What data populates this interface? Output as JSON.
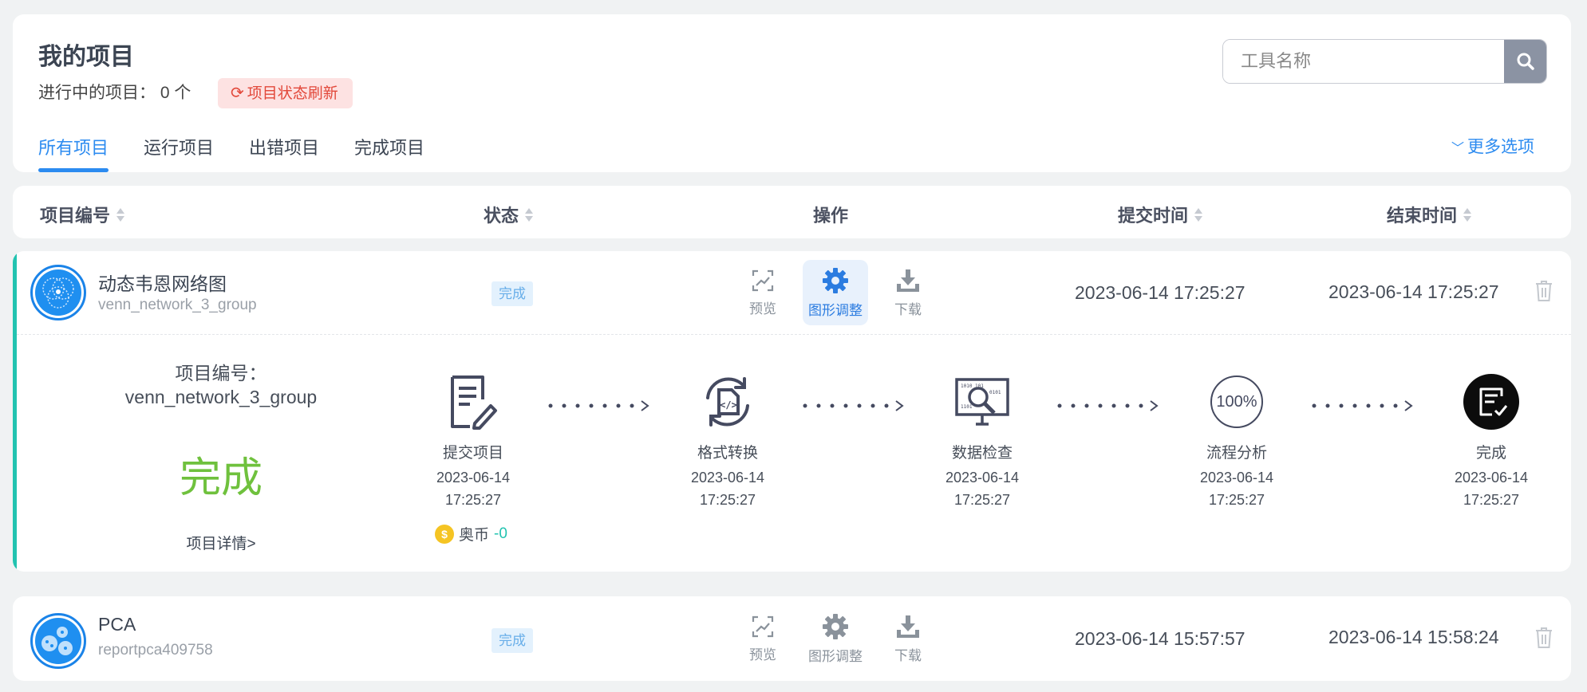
{
  "header": {
    "title": "我的项目",
    "running_label": "进行中的项目：",
    "running_count": "0 个",
    "refresh_label": "项目状态刷新",
    "search_placeholder": "工具名称",
    "more_options": "更多选项",
    "tabs": [
      "所有项目",
      "运行项目",
      "出错项目",
      "完成项目"
    ],
    "active_tab": "所有项目"
  },
  "columns": [
    "项目编号",
    "状态",
    "操作",
    "提交时间",
    "结束时间"
  ],
  "operations": [
    "预览",
    "图形调整",
    "下载"
  ],
  "projects": [
    {
      "name": "动态韦恩网络图",
      "id": "venn_network_3_group",
      "status": "完成",
      "submit_time": "2023-06-14 17:25:27",
      "end_time": "2023-06-14 17:25:27",
      "expanded": true
    },
    {
      "name": "PCA",
      "id": "reportpca409758",
      "status": "完成",
      "submit_time": "2023-06-14 15:57:57",
      "end_time": "2023-06-14 15:58:24",
      "expanded": false
    }
  ],
  "detail": {
    "id_label": "项目编号：",
    "id_value": "venn_network_3_group",
    "status": "完成",
    "details_link": "项目详情>",
    "coin_label": "奥币",
    "coin_amount": "-0",
    "steps": [
      {
        "name": "提交项目",
        "date": "2023-06-14",
        "time": "17:25:27"
      },
      {
        "name": "格式转换",
        "date": "2023-06-14",
        "time": "17:25:27"
      },
      {
        "name": "数据检查",
        "date": "2023-06-14",
        "time": "17:25:27"
      },
      {
        "name": "流程分析",
        "date": "2023-06-14",
        "time": "17:25:27",
        "badge": "100%"
      },
      {
        "name": "完成",
        "date": "2023-06-14",
        "time": "17:25:27"
      }
    ]
  },
  "colors": {
    "accent": "#2c8bf0",
    "success": "#6fc13d",
    "teal": "#22c3b0",
    "danger": "#e2483a"
  }
}
